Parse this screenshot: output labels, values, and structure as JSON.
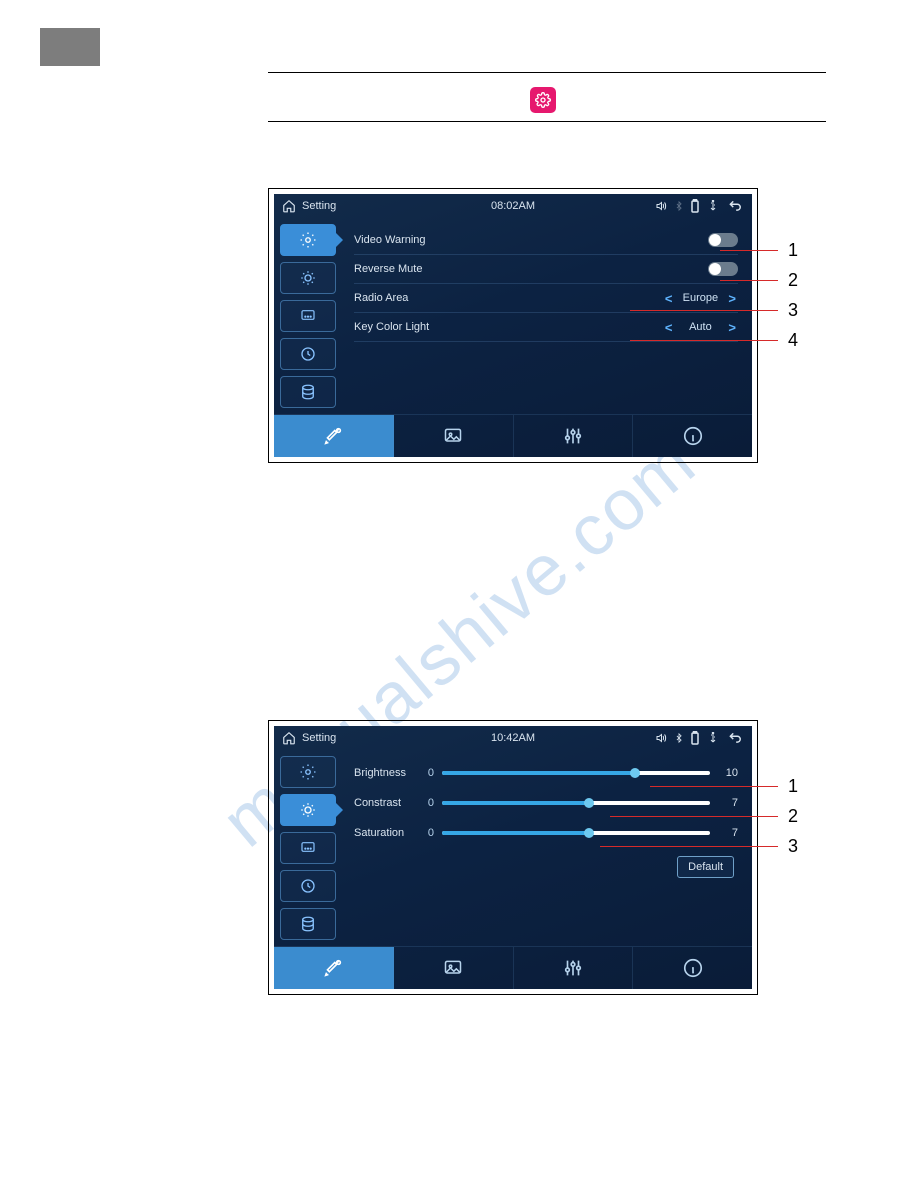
{
  "watermark": "manualshive.com",
  "fig1": {
    "title": "Setting",
    "time": "08:02AM",
    "rows": [
      {
        "label": "Video Warning"
      },
      {
        "label": "Reverse Mute"
      },
      {
        "label": "Radio Area",
        "value": "Europe"
      },
      {
        "label": "Key Color Light",
        "value": "Auto"
      }
    ],
    "callouts": [
      "1",
      "2",
      "3",
      "4"
    ]
  },
  "fig2": {
    "title": "Setting",
    "time": "10:42AM",
    "sliders": [
      {
        "label": "Brightness",
        "min": "0",
        "value": "10"
      },
      {
        "label": "Constrast",
        "min": "0",
        "value": "7"
      },
      {
        "label": "Saturation",
        "min": "0",
        "value": "7"
      }
    ],
    "default_label": "Default",
    "callouts": [
      "1",
      "2",
      "3"
    ]
  }
}
